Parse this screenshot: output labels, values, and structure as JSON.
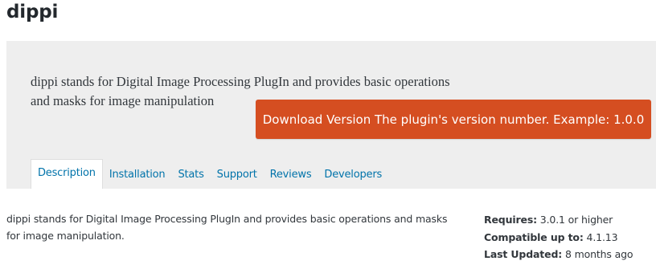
{
  "plugin": {
    "name": "dippi",
    "short_description": "dippi stands for Digital Image Processing PlugIn and provides basic operations and masks for image manipulation",
    "description": "dippi stands for Digital Image Processing PlugIn and provides basic operations and masks for image manipulation."
  },
  "download_button": {
    "label": "Download Version The plugin's version number. Example: 1.0.0",
    "color": "#d54e21"
  },
  "tabs": [
    {
      "label": "Description",
      "active": true
    },
    {
      "label": "Installation",
      "active": false
    },
    {
      "label": "Stats",
      "active": false
    },
    {
      "label": "Support",
      "active": false
    },
    {
      "label": "Reviews",
      "active": false
    },
    {
      "label": "Developers",
      "active": false
    }
  ],
  "meta": {
    "requires_label": "Requires:",
    "requires_value": "3.0.1 or higher",
    "compatible_label": "Compatible up to:",
    "compatible_value": "4.1.13",
    "updated_label": "Last Updated:",
    "updated_value": "8 months ago"
  },
  "colors": {
    "link": "#0073aa",
    "header_background": "#eeeeee"
  }
}
